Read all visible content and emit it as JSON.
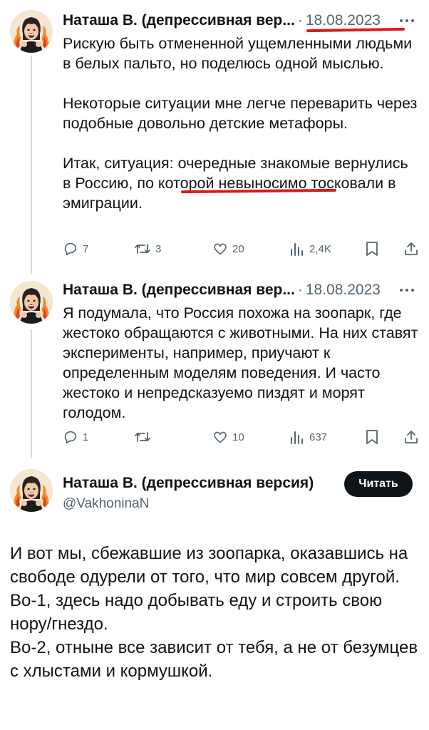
{
  "tweets": [
    {
      "author": "Наташа В. (депрессивная вер...",
      "separator": "·",
      "date": "18.08.2023",
      "paragraphs": [
        "Рискую быть отмененной ущемленными людьми в белых пальто, но поделюсь одной мыслью.",
        "Некоторые ситуации мне легче переварить через подобные довольно детские метафоры.",
        "Итак, ситуация: очередные знакомые вернулись в Россию, по которой невыносимо тосковали в эмиграции."
      ],
      "actions": {
        "replies": "7",
        "retweets": "3",
        "likes": "20",
        "views": "2,4K"
      }
    },
    {
      "author": "Наташа В. (депрессивная вер...",
      "separator": "·",
      "date": "18.08.2023",
      "paragraphs": [
        "Я подумала, что Россия похожа на зоопарк, где жестоко обращаются с животными. На них ставят эксперименты, например, приучают к определенным моделям поведения. И часто жестоко и непредсказуемо пиздят и морят голодом."
      ],
      "actions": {
        "replies": "1",
        "retweets": "",
        "likes": "10",
        "views": "637"
      }
    }
  ],
  "main_tweet": {
    "author": "Наташа В. (депрессивная версия)",
    "handle": "@VakhoninaN",
    "follow_label": "Читать",
    "lines": [
      "И вот мы, сбежавшие из зоопарка, оказавшись на свободе одурели от того, что мир совсем другой.",
      "Во-1, здесь надо добывать еду и строить свою нору/гнездо.",
      "Во-2, отныне все зависит от тебя, а не от безумцев с хлыстами и кормушкой."
    ]
  },
  "icons": {
    "reply": "reply-icon",
    "retweet": "retweet-icon",
    "like": "like-icon",
    "views": "views-icon",
    "bookmark": "bookmark-icon",
    "share": "share-icon",
    "more": "more-icon"
  },
  "colors": {
    "text": "#0f1419",
    "secondary": "#536471",
    "thread_line": "#cfd9de",
    "annotation_red": "#d81c17",
    "button_bg": "#0f1419"
  }
}
